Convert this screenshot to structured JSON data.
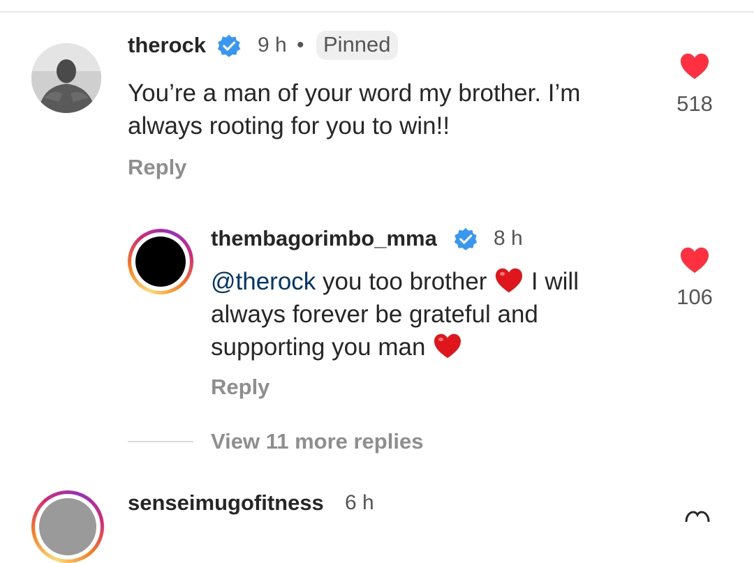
{
  "comments": [
    {
      "username": "therock",
      "time": "9 h",
      "pinned_label": "Pinned",
      "text": "You’re a man of your word my brother. I’m always rooting for you to win!!",
      "reply_label": "Reply",
      "likes": "518"
    }
  ],
  "reply": {
    "username": "thembagorimbo_mma",
    "time": "8 h",
    "mention": "@therock",
    "text_part1": " you too brother ",
    "text_part2": " I will always forever be grateful and supporting you man ",
    "reply_label": "Reply",
    "likes": "106"
  },
  "view_more_replies": "View 11 more replies",
  "next_comment": {
    "username": "senseimugofitness",
    "time": "6 h"
  },
  "colors": {
    "heart": "#ff3040",
    "verified": "#3897f0",
    "mention": "#00376b"
  }
}
